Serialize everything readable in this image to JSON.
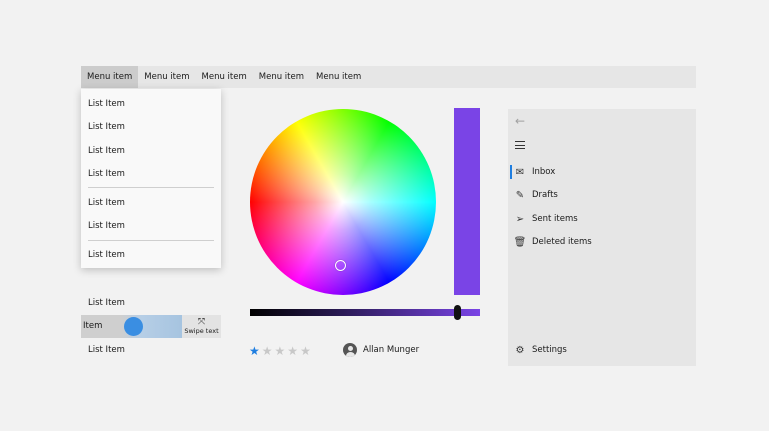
{
  "menubar": {
    "items": [
      "Menu item",
      "Menu item",
      "Menu item",
      "Menu item",
      "Menu item"
    ],
    "active_index": 0
  },
  "dropdown": {
    "items": [
      "List Item",
      "List Item",
      "List Item",
      "List Item",
      "List Item",
      "List Item",
      "List Item"
    ]
  },
  "listview": {
    "item_top": "List Item",
    "item_bottom": "List Item",
    "swipe": {
      "item_label": "Item",
      "action_icon": "expand-icon",
      "action_label": "Swipe text"
    }
  },
  "color_picker": {
    "selected_color": "#7a44e6",
    "value_fraction": 0.9
  },
  "rating": {
    "value": 1,
    "max": 5,
    "accent": "#1f7ee0"
  },
  "persona": {
    "name": "Allan Munger"
  },
  "navigation": {
    "back_icon": "back-arrow-icon",
    "menu_icon": "hamburger-icon",
    "items": [
      {
        "icon": "mail-icon",
        "label": "Inbox",
        "selected": true
      },
      {
        "icon": "pencil-icon",
        "label": "Drafts",
        "selected": false
      },
      {
        "icon": "send-icon",
        "label": "Sent items",
        "selected": false
      },
      {
        "icon": "trash-icon",
        "label": "Deleted items",
        "selected": false
      }
    ],
    "settings": {
      "icon": "gear-icon",
      "label": "Settings"
    }
  }
}
